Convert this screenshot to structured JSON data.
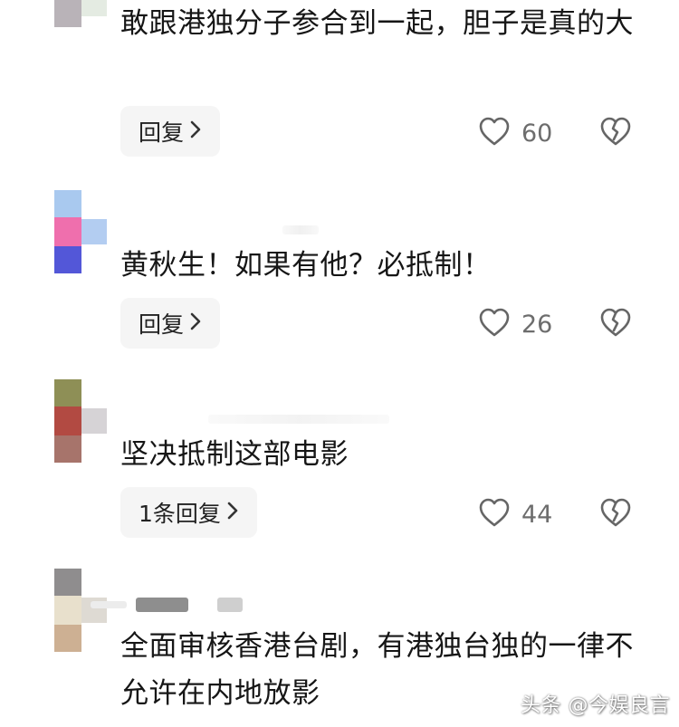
{
  "comments": [
    {
      "text": "敢跟港独分子参合到一起，胆子是真的大",
      "reply_label": "回复",
      "likes": "60"
    },
    {
      "text": "黄秋生！如果有他？必抵制！",
      "reply_label": "回复",
      "likes": "26"
    },
    {
      "text": "坚决抵制这部电影",
      "reply_label": "1条回复",
      "likes": "44"
    },
    {
      "text": "全面审核香港台剧，有港独台独的一律不允许在内地放影"
    }
  ],
  "watermark": "头条 @今娱良言",
  "icons": {
    "reply_arrow": "chevron-right-icon",
    "like": "heart-outline-icon",
    "dislike": "broken-heart-icon"
  },
  "colors": {
    "reply_bg": "#f5f5f5",
    "count_text": "#6d6d6d",
    "icon_stroke": "#666666"
  }
}
